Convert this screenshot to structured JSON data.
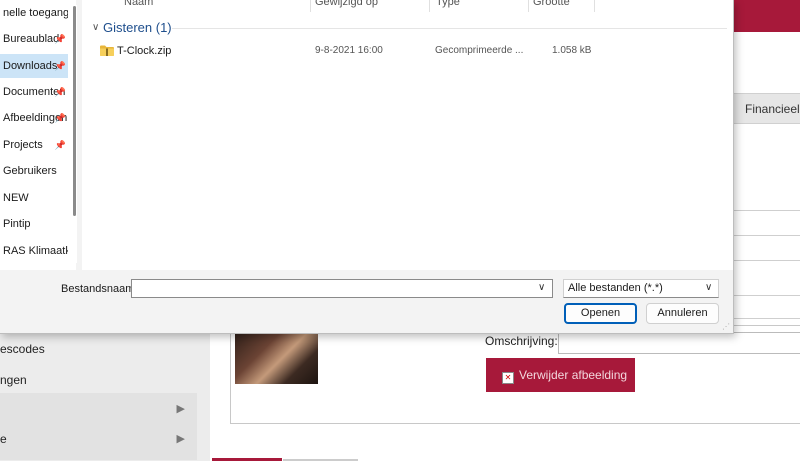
{
  "dialog": {
    "nav": {
      "items": [
        {
          "label": "nelle toegang",
          "pinned": false,
          "selected": false
        },
        {
          "label": "Bureaublad",
          "pinned": true,
          "selected": false
        },
        {
          "label": "Downloads",
          "pinned": true,
          "selected": true
        },
        {
          "label": "Documenten",
          "pinned": true,
          "selected": false
        },
        {
          "label": "Afbeeldingen",
          "pinned": true,
          "selected": false
        },
        {
          "label": "Projects",
          "pinned": true,
          "selected": false
        },
        {
          "label": "Gebruikers",
          "pinned": false,
          "selected": false
        },
        {
          "label": "NEW",
          "pinned": false,
          "selected": false
        },
        {
          "label": "Pintip",
          "pinned": false,
          "selected": false
        },
        {
          "label": "RAS Klimaatkast",
          "pinned": false,
          "selected": false
        }
      ]
    },
    "columns": {
      "name": "Naam",
      "modified": "Gewijzigd op",
      "type": "Type",
      "size": "Grootte"
    },
    "group": {
      "label": "Gisteren (1)",
      "files": [
        {
          "icon": "zip-folder-icon",
          "name": "T-Clock.zip",
          "modified": "9-8-2021 16:00",
          "type": "Gecomprimeerde ...",
          "size": "1.058 kB"
        }
      ]
    },
    "filename": {
      "label": "Bestandsnaam:",
      "value": ""
    },
    "filetype": {
      "selected": "Alle bestanden (*.*)"
    },
    "buttons": {
      "open": "Openen",
      "cancel": "Annuleren"
    }
  },
  "background": {
    "tab_label": "Financieel",
    "description_label": "Omschrijving:",
    "delete_button": "Verwijder afbeelding",
    "sidebar": [
      {
        "label": "escodes",
        "chevron": false
      },
      {
        "label": "ngen",
        "chevron": false
      },
      {
        "label": "",
        "chevron": true
      },
      {
        "label": "e",
        "chevron": true
      }
    ],
    "accent_color": "#a7193a"
  }
}
